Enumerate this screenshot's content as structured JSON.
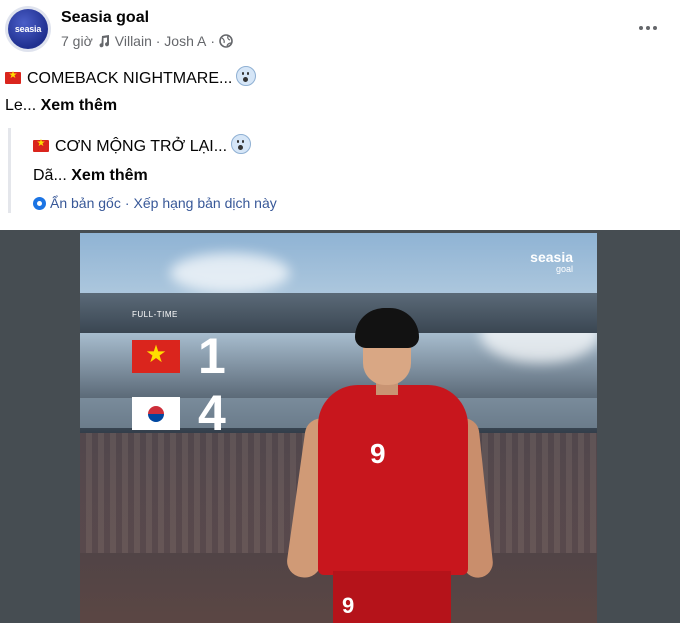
{
  "post": {
    "page_name": "Seasia goal",
    "avatar_text": "seasia",
    "time": "7 giờ",
    "music": "Villain · Josh A",
    "separator": "·",
    "original": {
      "headline": "COMEBACK NIGHTMARE...",
      "preview": "Le...",
      "see_more": "Xem thêm"
    },
    "translation": {
      "headline": "CƠN MỘNG TRỞ LẠI...",
      "preview": "Dã...",
      "see_more": "Xem thêm",
      "hide_original": "Ẩn bản gốc",
      "rate_translation": "Xếp hạng bản dịch này"
    }
  },
  "image": {
    "brand": "seasia",
    "brand_sub": "goal",
    "full_time_label": "FULL-TIME",
    "score_vn": "1",
    "score_kr": "4",
    "jersey_number": "9"
  }
}
